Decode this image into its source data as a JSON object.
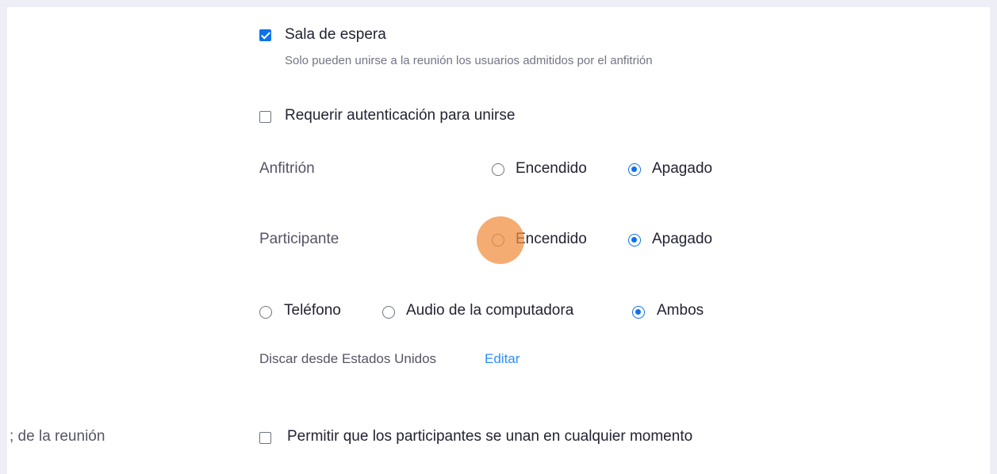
{
  "waiting_room": {
    "label": "Sala de espera",
    "checked": true,
    "description": "Solo pueden unirse a la reunión los usuarios admitidos por el anfitrión"
  },
  "require_auth": {
    "label": "Requerir autenticación para unirse",
    "checked": false
  },
  "video": {
    "host": {
      "label": "Anfitrión",
      "on_label": "Encendido",
      "off_label": "Apagado",
      "selected": "off"
    },
    "participant": {
      "label": "Participante",
      "on_label": "Encendido",
      "off_label": "Apagado",
      "selected": "off"
    }
  },
  "audio": {
    "options": [
      "Teléfono",
      "Audio de la computadora",
      "Ambos"
    ],
    "selected": "Ambos"
  },
  "dial_in": {
    "prefix": "Discar desde",
    "country": "Estados Unidos",
    "edit_label": "Editar"
  },
  "meeting_options": {
    "section_label": "; de la reunión",
    "join_anytime_label": "Permitir que los participantes se unan en cualquier momento",
    "join_anytime_checked": false
  },
  "colors": {
    "accent": "#0e71eb",
    "link": "#2d8cff",
    "click_indicator": "#f08c3c",
    "page_background": "#eeeef6"
  }
}
